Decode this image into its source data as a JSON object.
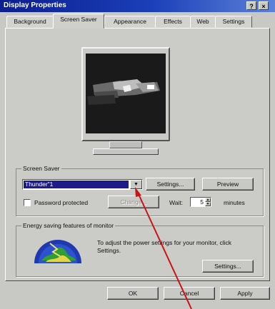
{
  "window": {
    "title": "Display Properties",
    "help_button": "?",
    "close_button": "×"
  },
  "tabs": [
    {
      "label": "Background"
    },
    {
      "label": "Screen Saver"
    },
    {
      "label": "Appearance"
    },
    {
      "label": "Effects"
    },
    {
      "label": "Web"
    },
    {
      "label": "Settings"
    }
  ],
  "screen_saver": {
    "group_label": "Screen Saver",
    "selected": "Thunder\"1",
    "settings_button": "Settings...",
    "preview_button": "Preview",
    "password_label": "Password protected",
    "change_button": "Change...",
    "wait_label": "Wait:",
    "wait_value": "5",
    "minutes_label": "minutes",
    "password_checked": false
  },
  "energy": {
    "group_label": "Energy saving features of monitor",
    "description": "To adjust the power settings for your monitor, click Settings.",
    "settings_button": "Settings..."
  },
  "footer": {
    "ok": "OK",
    "cancel": "Cancel",
    "apply": "Apply"
  },
  "icons": {
    "dropdown": "chevron-down-icon",
    "energy": "energy-star-icon",
    "annotation": "annotation-arrow"
  },
  "colors": {
    "title_bar": "#0c1f8f",
    "selection": "#1d1b8a",
    "dialog": "#c8c8c4",
    "annotation_arrow": "#c81414"
  }
}
